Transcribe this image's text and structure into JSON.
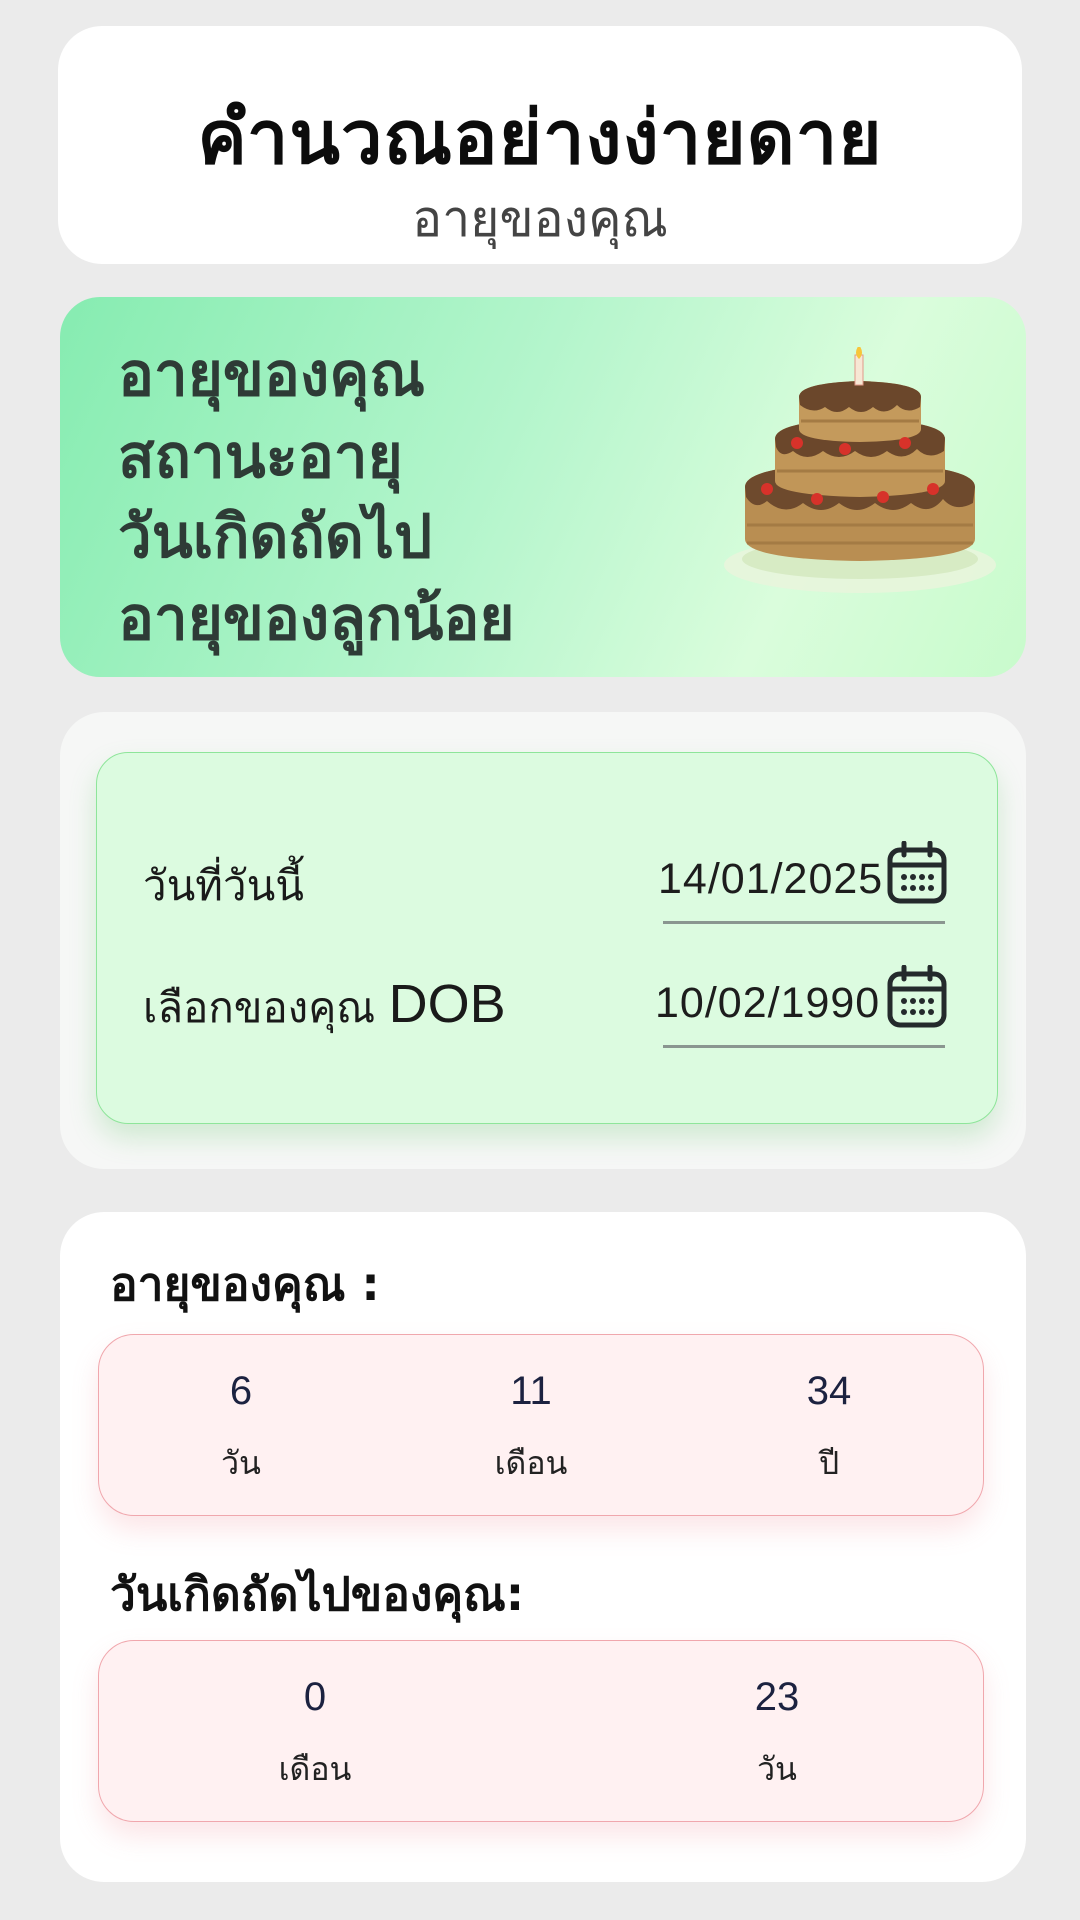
{
  "header": {
    "title": "คำนวณอย่างง่ายดาย",
    "subtitle": "อายุของคุณ"
  },
  "banner": {
    "lines": [
      "อายุของคุณ",
      "สถานะอายุ",
      "วันเกิดถัดไป",
      "อายุของลูกน้อย"
    ],
    "image_icon": "birthday-cake-icon"
  },
  "form": {
    "today_label": "วันที่วันนี้",
    "today_value": "14/01/2025",
    "dob_label_thai": "เลือกของคุณ",
    "dob_label_latin": "DOB",
    "dob_value": "10/02/1990",
    "calendar_icon": "calendar-icon"
  },
  "age": {
    "heading": "อายุของคุณ :",
    "items": [
      {
        "value": "6",
        "unit": "วัน"
      },
      {
        "value": "11",
        "unit": "เดือน"
      },
      {
        "value": "34",
        "unit": "ปี"
      }
    ]
  },
  "next_birthday": {
    "heading": "วันเกิดถัดไปของคุณ:",
    "items": [
      {
        "value": "0",
        "unit": "เดือน"
      },
      {
        "value": "23",
        "unit": "วัน"
      }
    ]
  },
  "colors": {
    "page_bg": "#ebebeb",
    "banner_green": "#86ecb1",
    "form_green": "#dcfbe0",
    "result_pink": "#fff1f2",
    "result_border": "#f0a7ad"
  }
}
